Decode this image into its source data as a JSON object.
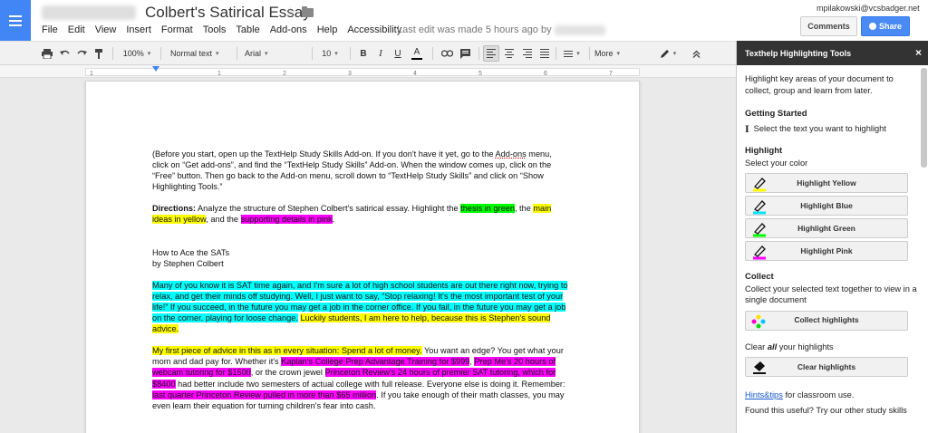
{
  "header": {
    "title": "Colbert's Satirical Essay",
    "last_edit": "Last edit was made 5 hours ago by",
    "user_email": "mpilakowski@vcsbadger.net",
    "comments_label": "Comments",
    "share_label": "Share"
  },
  "menu": [
    "File",
    "Edit",
    "View",
    "Insert",
    "Format",
    "Tools",
    "Table",
    "Add-ons",
    "Help",
    "Accessibility"
  ],
  "toolbar": {
    "zoom": "100%",
    "style": "Normal text",
    "font": "Arial",
    "font_size": "10",
    "bold": "B",
    "italic": "I",
    "underline": "U",
    "text_color": "A",
    "more": "More"
  },
  "ruler": [
    "1",
    "1",
    "2",
    "3",
    "4",
    "5",
    "6",
    "7"
  ],
  "document": {
    "intro_1": "(Before you start, open up the TextHelp Study Skills Add-on.  If you don't have it yet, go to the ",
    "intro_link": "Add-ons",
    "intro_2": " menu, click on “Get add-ons”, and find the “TextHelp Study Skills” Add-on. When the window comes up, click on the “Free” button.  Then go back to the Add-on menu, scroll down to “TextHelp Study Skills” and click on “Show Highlighting Tools.”",
    "directions_label": "Directions:",
    "directions_1": "  Analyze the structure of Stephen Colbert's satirical essay.  Highlight the ",
    "directions_green": "thesis in green",
    "directions_2": ", the ",
    "directions_yellow": "main ideas in yellow",
    "directions_3": ", and the ",
    "directions_pink": "supporting details in pink",
    "directions_4": ".",
    "essay_title": "How to Ace the SATs",
    "essay_author": "by Stephen Colbert",
    "p1_cyan": "Many of you know it is SAT time again, and I'm sure a lot of high school students are out there right now, trying to relax, and get their minds off studying.  Well, I just want to say, “Stop relaxing!  It's the most important test of your life!”  If you succeed, in the future you may get a job in the corner office.  If you fail, in the future you may get a job on the corner, playing for loose change.",
    "p1_gap": "  ",
    "p1_yellow": "Luckily students, I am here to help, because this is Stephen's sound advice.",
    "p2_yellow": "My first piece of advice in this as in every situation:  Spend a lot of money.",
    "p2_1": "  You want an edge?  You get what your mom and dad pay for.  Whether it's ",
    "p2_pink1": "Kaplan's College Prep Advantage Training for $999",
    "p2_2": ", ",
    "p2_pink2": "Prep Me's 20 hours of webcam tutoring for $1500",
    "p2_3": ", or the crown jewel ",
    "p2_pink3": "Princeton Review's 24 hours of premier SAT tutoring, which for $8400",
    "p2_4": " had better include two semesters of actual college with full release.  Everyone else is doing it.  Remember:  ",
    "p2_pink4": "last quarter Princeton Review pulled in more than $65 million",
    "p2_5": ".  If you take enough of their math classes, you may even learn their equation for turning children's fear into cash."
  },
  "sidebar": {
    "title": "Texthelp Highlighting Tools",
    "close": "×",
    "intro": "Highlight key areas of your document to collect, group and learn from later.",
    "getting_started_heading": "Getting Started",
    "getting_started_text": "Select the text you want to highlight",
    "highlight_heading": "Highlight",
    "highlight_sub": "Select your color",
    "buttons": [
      {
        "label": "Highlight Yellow",
        "color": "#ffff00"
      },
      {
        "label": "Highlight Blue",
        "color": "#00e5ff"
      },
      {
        "label": "Highlight Green",
        "color": "#00ff00"
      },
      {
        "label": "Highlight Pink",
        "color": "#ff00ff"
      }
    ],
    "collect_heading": "Collect",
    "collect_text": "Collect your selected text together to view in a single document",
    "collect_button": "Collect highlights",
    "clear_text_1": "Clear ",
    "clear_text_bold": "all",
    "clear_text_2": " your highlights",
    "clear_button": "Clear highlights",
    "hints_link": "Hints&tips",
    "hints_text": " for classroom use.",
    "found_useful": "Found this useful? Try our other study skills"
  }
}
